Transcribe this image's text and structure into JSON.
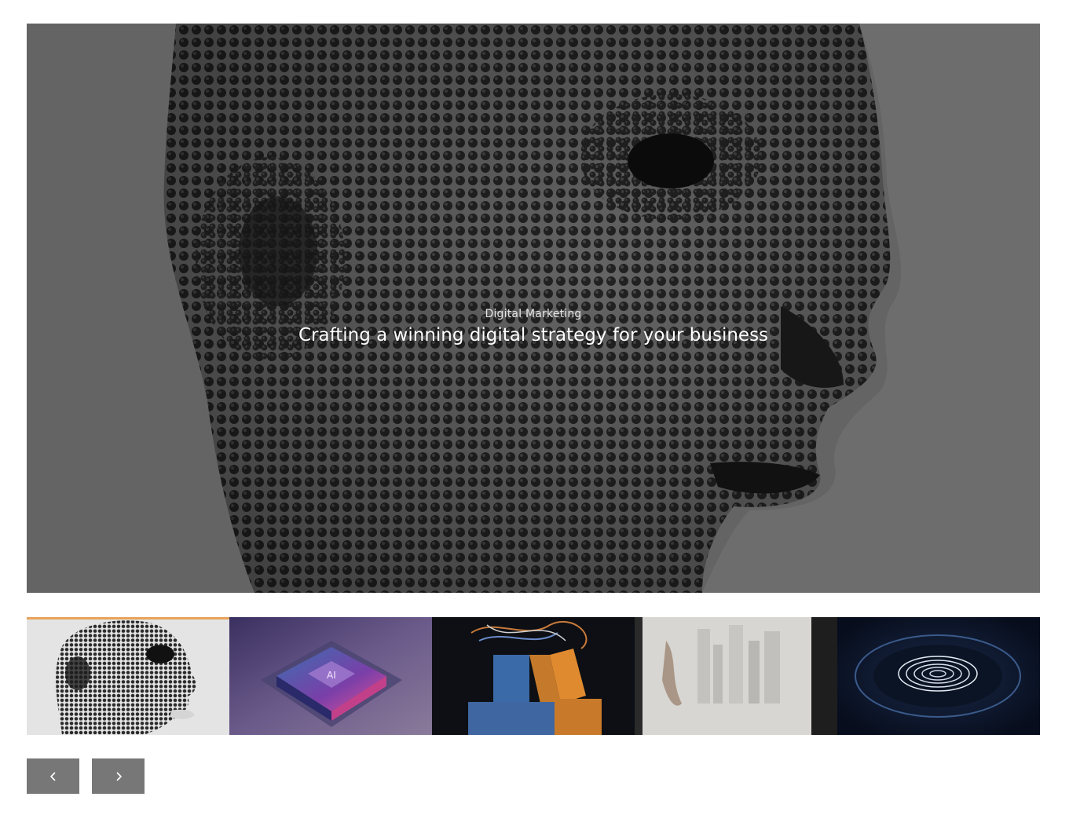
{
  "slider": {
    "active_index": 0,
    "slide": {
      "category": "Digital Marketing",
      "title": "Crafting a winning digital strategy for your business",
      "image_icon": "wireframe-head-image"
    },
    "thumbnails": [
      {
        "icon": "wireframe-head-thumbnail",
        "active": true
      },
      {
        "icon": "ai-chip-thumbnail",
        "active": false
      },
      {
        "icon": "paper-sculpture-thumbnail",
        "active": false
      },
      {
        "icon": "city-relief-thumbnail",
        "active": false
      },
      {
        "icon": "fingerprint-thumbnail",
        "active": false
      }
    ],
    "controls": {
      "prev_icon": "chevron-left-icon",
      "next_icon": "chevron-right-icon"
    }
  },
  "colors": {
    "active_indicator": "#e8a25a",
    "nav_button": "#777777"
  }
}
